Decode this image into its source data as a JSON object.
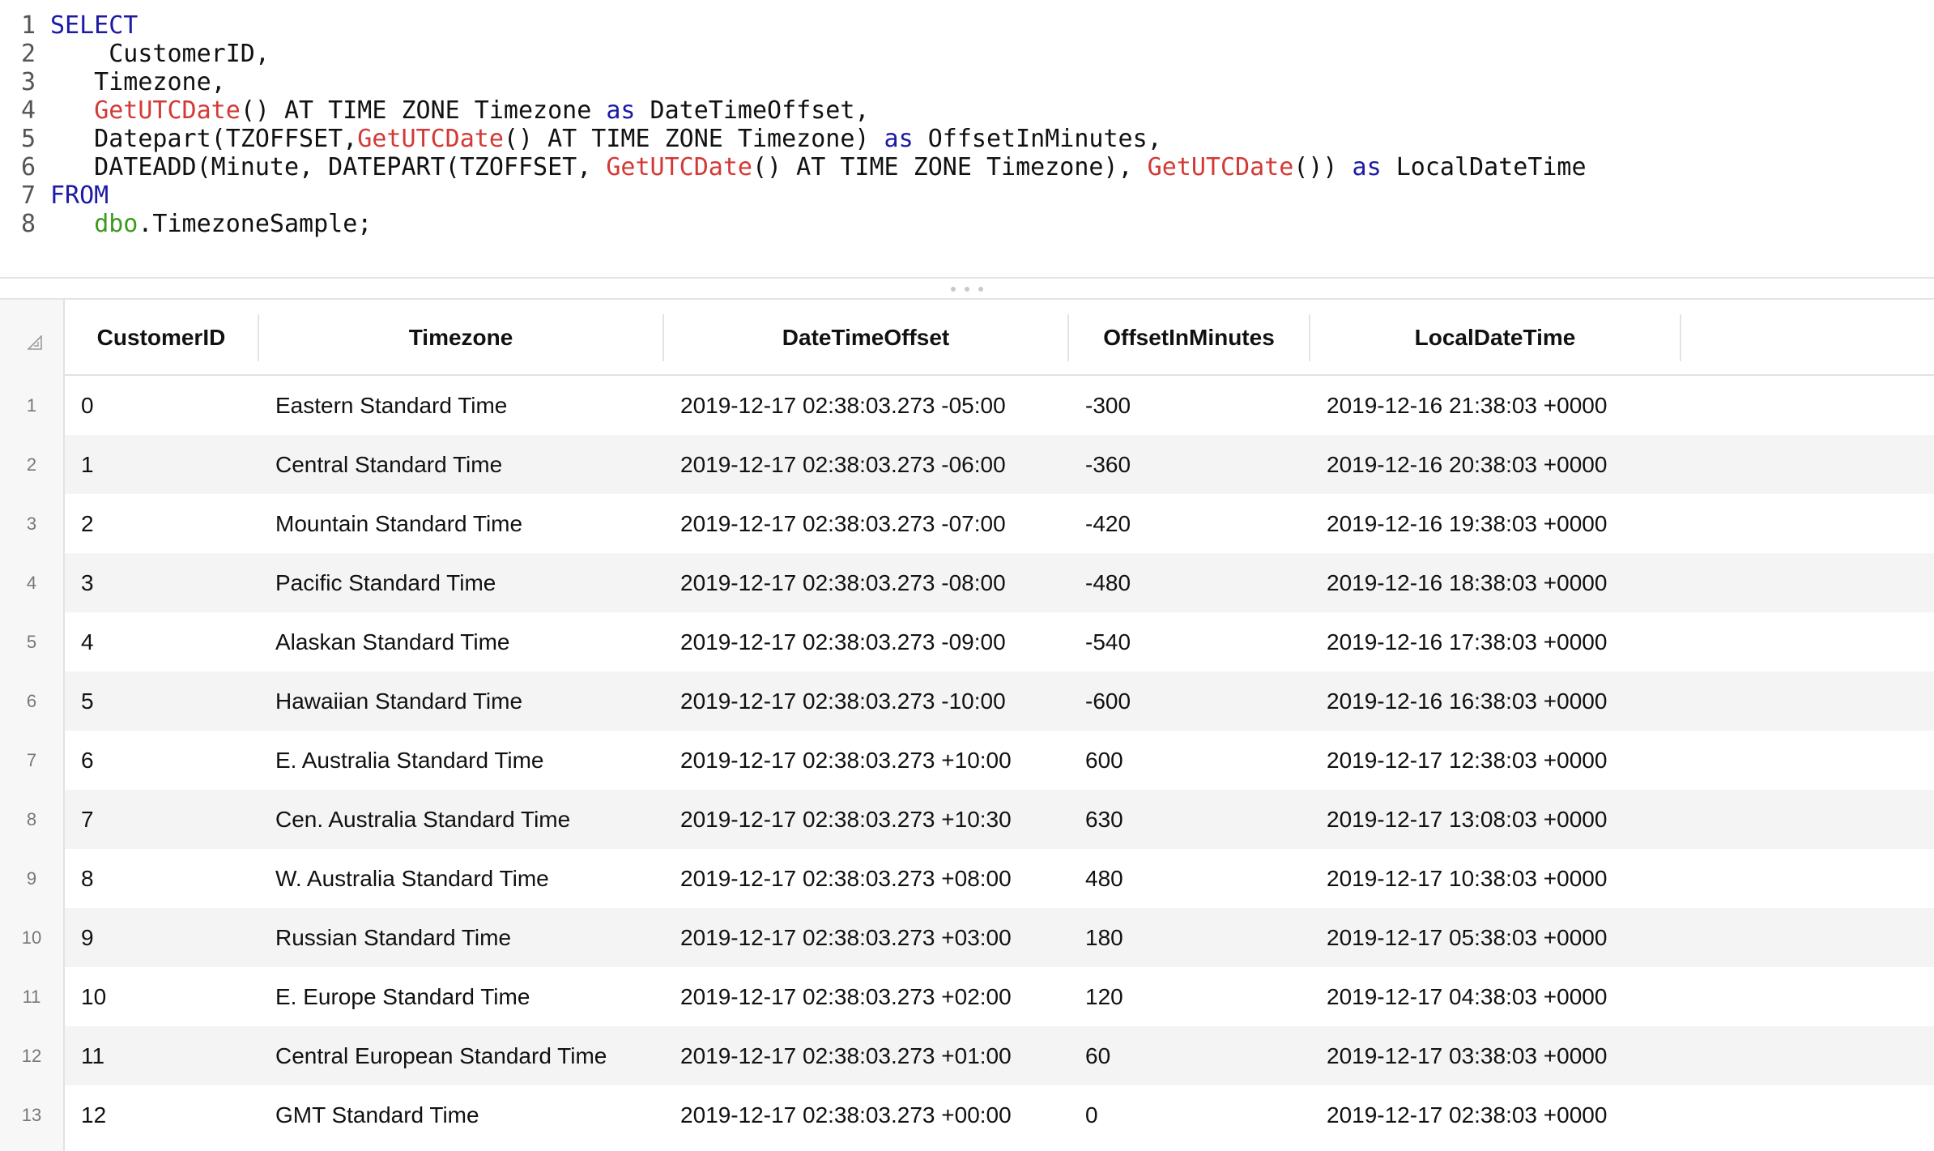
{
  "editor": {
    "lines": [
      {
        "num": "1",
        "tokens": [
          {
            "t": "SELECT",
            "c": "keyword"
          }
        ]
      },
      {
        "num": "2",
        "tokens": [
          {
            "t": "    CustomerID,",
            "c": "plain"
          }
        ]
      },
      {
        "num": "3",
        "tokens": [
          {
            "t": "   Timezone,",
            "c": "plain"
          }
        ]
      },
      {
        "num": "4",
        "tokens": [
          {
            "t": "   ",
            "c": "plain"
          },
          {
            "t": "GetUTCDate",
            "c": "func"
          },
          {
            "t": "() AT TIME ZONE Timezone ",
            "c": "plain"
          },
          {
            "t": "as",
            "c": "keyword"
          },
          {
            "t": " DateTimeOffset,",
            "c": "plain"
          }
        ]
      },
      {
        "num": "5",
        "tokens": [
          {
            "t": "   Datepart(TZOFFSET,",
            "c": "plain"
          },
          {
            "t": "GetUTCDate",
            "c": "func"
          },
          {
            "t": "() AT TIME ZONE Timezone) ",
            "c": "plain"
          },
          {
            "t": "as",
            "c": "keyword"
          },
          {
            "t": " OffsetInMinutes,",
            "c": "plain"
          }
        ]
      },
      {
        "num": "6",
        "tokens": [
          {
            "t": "   DATEADD(Minute, DATEPART(TZOFFSET, ",
            "c": "plain"
          },
          {
            "t": "GetUTCDate",
            "c": "func"
          },
          {
            "t": "() AT TIME ZONE Timezone), ",
            "c": "plain"
          },
          {
            "t": "GetUTCDate",
            "c": "func"
          },
          {
            "t": "()) ",
            "c": "plain"
          },
          {
            "t": "as",
            "c": "keyword"
          },
          {
            "t": " LocalDateTime",
            "c": "plain"
          }
        ]
      },
      {
        "num": "7",
        "tokens": [
          {
            "t": "FROM",
            "c": "keyword"
          }
        ]
      },
      {
        "num": "8",
        "tokens": [
          {
            "t": "   ",
            "c": "plain"
          },
          {
            "t": "dbo",
            "c": "schema"
          },
          {
            "t": ".TimezoneSample;",
            "c": "plain"
          }
        ]
      }
    ]
  },
  "grid": {
    "columns": [
      "CustomerID",
      "Timezone",
      "DateTimeOffset",
      "OffsetInMinutes",
      "LocalDateTime"
    ],
    "rows": [
      {
        "n": "1",
        "cells": [
          "0",
          "Eastern Standard Time",
          "2019-12-17 02:38:03.273 -05:00",
          "-300",
          "2019-12-16 21:38:03 +0000"
        ]
      },
      {
        "n": "2",
        "cells": [
          "1",
          "Central Standard Time",
          "2019-12-17 02:38:03.273 -06:00",
          "-360",
          "2019-12-16 20:38:03 +0000"
        ]
      },
      {
        "n": "3",
        "cells": [
          "2",
          "Mountain Standard Time",
          "2019-12-17 02:38:03.273 -07:00",
          "-420",
          "2019-12-16 19:38:03 +0000"
        ]
      },
      {
        "n": "4",
        "cells": [
          "3",
          "Pacific Standard Time",
          "2019-12-17 02:38:03.273 -08:00",
          "-480",
          "2019-12-16 18:38:03 +0000"
        ]
      },
      {
        "n": "5",
        "cells": [
          "4",
          "Alaskan Standard Time",
          "2019-12-17 02:38:03.273 -09:00",
          "-540",
          "2019-12-16 17:38:03 +0000"
        ]
      },
      {
        "n": "6",
        "cells": [
          "5",
          "Hawaiian Standard Time",
          "2019-12-17 02:38:03.273 -10:00",
          "-600",
          "2019-12-16 16:38:03 +0000"
        ]
      },
      {
        "n": "7",
        "cells": [
          "6",
          "E. Australia Standard Time",
          "2019-12-17 02:38:03.273 +10:00",
          "600",
          "2019-12-17 12:38:03 +0000"
        ]
      },
      {
        "n": "8",
        "cells": [
          "7",
          "Cen. Australia Standard Time",
          "2019-12-17 02:38:03.273 +10:30",
          "630",
          "2019-12-17 13:08:03 +0000"
        ]
      },
      {
        "n": "9",
        "cells": [
          "8",
          "W. Australia Standard Time",
          "2019-12-17 02:38:03.273 +08:00",
          "480",
          "2019-12-17 10:38:03 +0000"
        ]
      },
      {
        "n": "10",
        "cells": [
          "9",
          "Russian Standard Time",
          "2019-12-17 02:38:03.273 +03:00",
          "180",
          "2019-12-17 05:38:03 +0000"
        ]
      },
      {
        "n": "11",
        "cells": [
          "10",
          "E. Europe Standard Time",
          "2019-12-17 02:38:03.273 +02:00",
          "120",
          "2019-12-17 04:38:03 +0000"
        ]
      },
      {
        "n": "12",
        "cells": [
          "11",
          "Central European Standard Time",
          "2019-12-17 02:38:03.273 +01:00",
          "60",
          "2019-12-17 03:38:03 +0000"
        ]
      },
      {
        "n": "13",
        "cells": [
          "12",
          "GMT Standard Time",
          "2019-12-17 02:38:03.273 +00:00",
          "0",
          "2019-12-17 02:38:03 +0000"
        ]
      }
    ]
  },
  "icons": {
    "corner": "sort-corner-icon",
    "splitter": "drag-handle-icon"
  },
  "colors": {
    "keyword": "#1c1aa6",
    "function": "#d33a36",
    "schema": "#3d9a1e",
    "row_alt": "#f4f4f4"
  }
}
